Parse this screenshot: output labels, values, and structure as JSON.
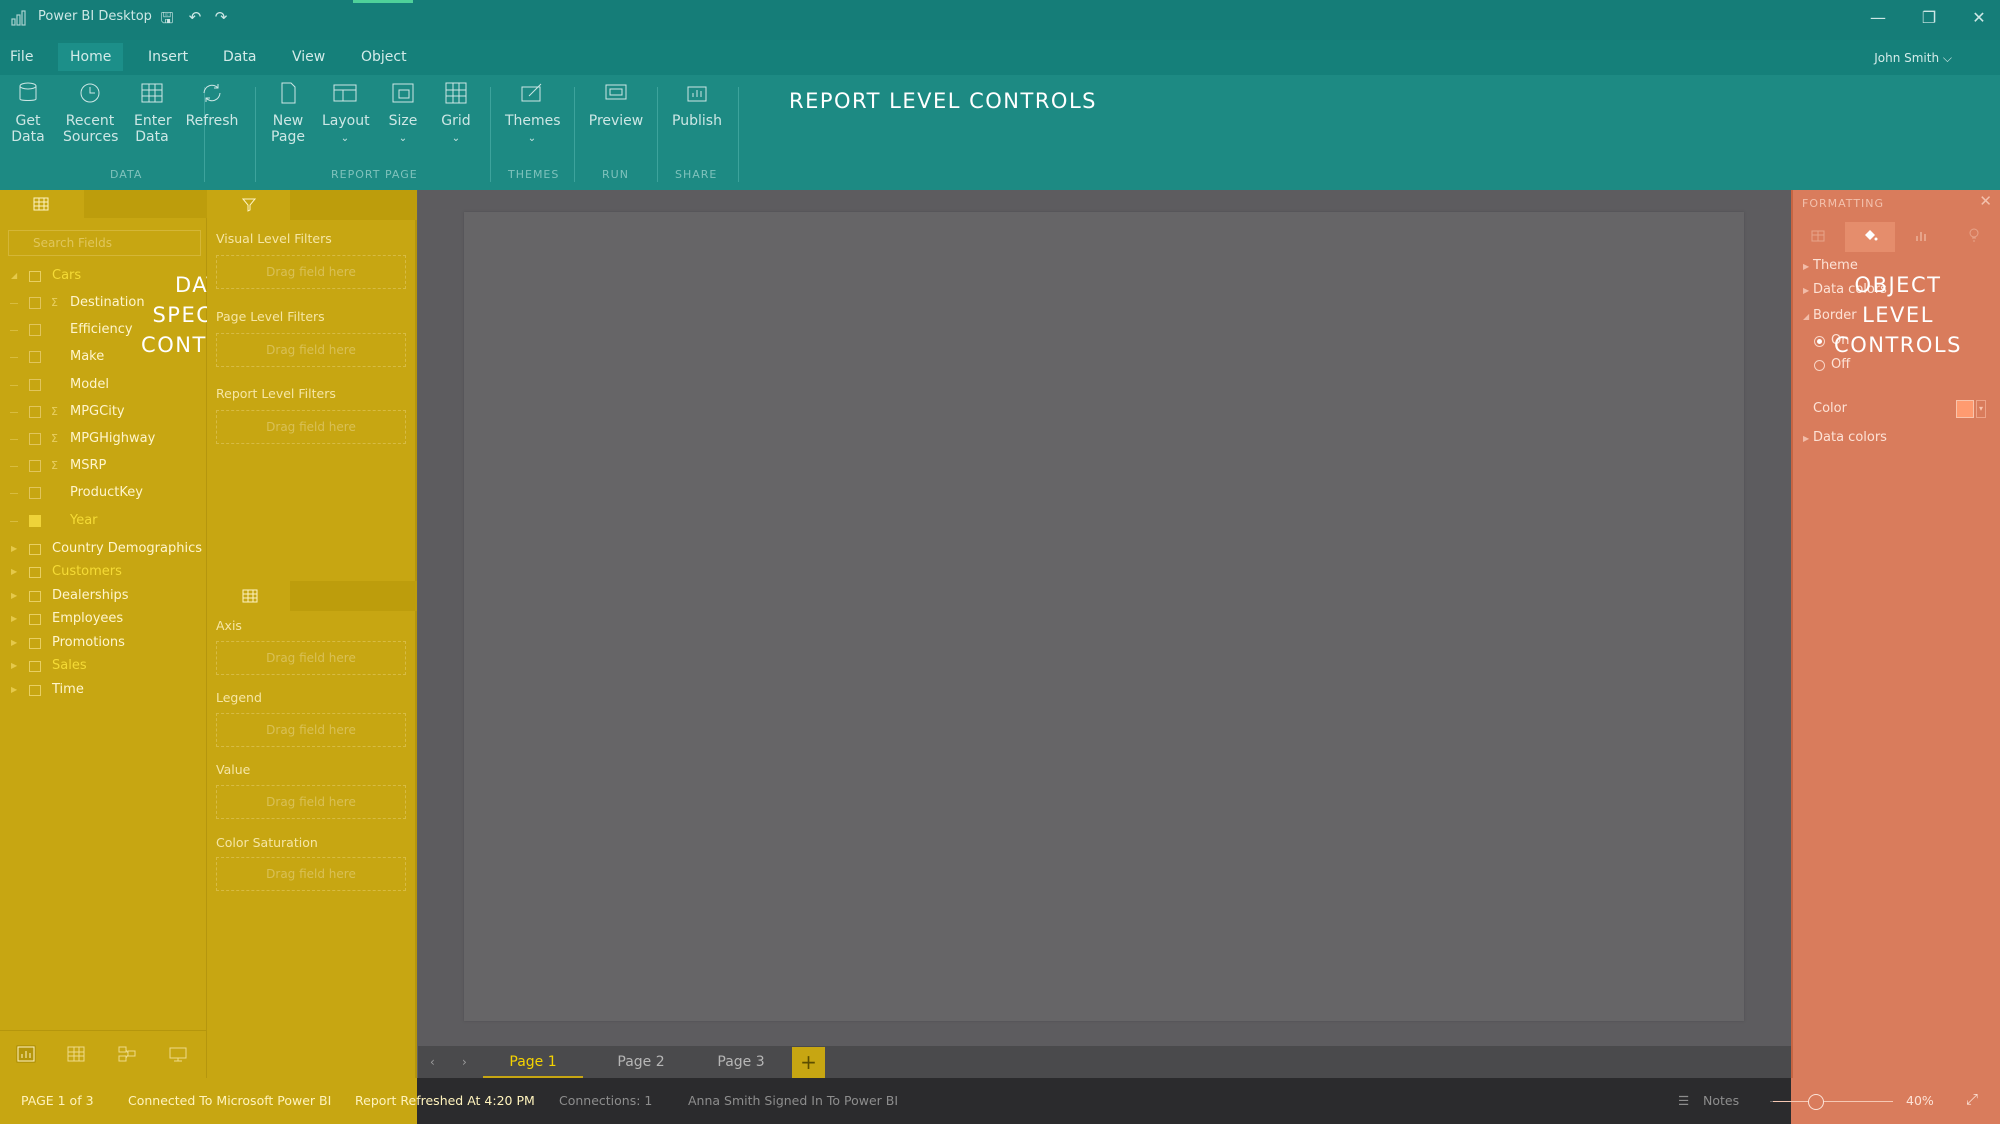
{
  "app": {
    "title": "Power BI Desktop"
  },
  "window": {
    "minimize": "—",
    "restore": "❐",
    "close": "✕"
  },
  "quick_access": {
    "save": "🖫",
    "undo": "↶",
    "redo": "↷"
  },
  "menu": {
    "items": [
      "File",
      "Home",
      "Insert",
      "Data",
      "View",
      "Object"
    ],
    "active": "Home",
    "user": "John Smith",
    "user_chevron": "⌵"
  },
  "ribbon": {
    "buttons": {
      "get_data": "Get\nData",
      "recent_sources": "Recent\nSources",
      "enter_data": "Enter\nData",
      "refresh": "Refresh",
      "new_page": "New\nPage",
      "layout": "Layout",
      "size": "Size",
      "grid": "Grid",
      "themes": "Themes",
      "preview": "Preview",
      "publish": "Publish"
    },
    "dropdown_marker": "⌄",
    "groups": {
      "data": "DATA",
      "report_page": "REPORT PAGE",
      "themes": "THEMES",
      "run": "RUN",
      "share": "SHARE"
    },
    "overlay_label": "REPORT LEVEL CONTROLS"
  },
  "fields_pane": {
    "search_placeholder": "Search Fields",
    "overlay_label": "DATA\nSPECIFIC\nCONTROLS",
    "expanded_table": "Cars",
    "fields": [
      {
        "name": "Destination",
        "sigma": true,
        "checked": false
      },
      {
        "name": "Efficiency",
        "sigma": false,
        "checked": false
      },
      {
        "name": "Make",
        "sigma": false,
        "checked": false
      },
      {
        "name": "Model",
        "sigma": false,
        "checked": false
      },
      {
        "name": "MPGCity",
        "sigma": true,
        "checked": false
      },
      {
        "name": "MPGHighway",
        "sigma": true,
        "checked": false
      },
      {
        "name": "MSRP",
        "sigma": true,
        "checked": false
      },
      {
        "name": "ProductKey",
        "sigma": false,
        "checked": false
      },
      {
        "name": "Year",
        "sigma": false,
        "checked": true
      }
    ],
    "tables": [
      {
        "name": "Country Demographics",
        "highlight": false
      },
      {
        "name": "Customers",
        "highlight": true
      },
      {
        "name": "Dealerships",
        "highlight": false
      },
      {
        "name": "Employees",
        "highlight": false
      },
      {
        "name": "Promotions",
        "highlight": false
      },
      {
        "name": "Sales",
        "highlight": true
      },
      {
        "name": "Time",
        "highlight": false
      }
    ]
  },
  "filters_pane": {
    "visual_level": "Visual Level Filters",
    "page_level": "Page Level Filters",
    "report_level": "Report Level Filters",
    "drop_hint": "Drag field here",
    "wells": [
      "Axis",
      "Legend",
      "Value",
      "Color Saturation"
    ]
  },
  "pages": {
    "tabs": [
      "Page 1",
      "Page 2",
      "Page 3"
    ],
    "active": "Page 1",
    "add": "+",
    "prev": "‹",
    "next": "›"
  },
  "format_pane": {
    "title": "FORMATTING",
    "close": "✕",
    "overlay_label": "OBJECT\nLEVEL\nCONTROLS",
    "sections": {
      "theme": "Theme",
      "data_colors": "Data colors",
      "border": "Border",
      "on": "On",
      "off": "Off",
      "color": "Color",
      "data_colors_2": "Data colors"
    }
  },
  "status": {
    "page": "PAGE 1 of 3",
    "connected": "Connected To Microsoft Power BI",
    "refreshed": "Report Refreshed At 4:20 PM",
    "connections": "Connections: 1",
    "signed_in": "Anna Smith Signed In To Power BI",
    "notes": "Notes",
    "zoom": "40%"
  }
}
